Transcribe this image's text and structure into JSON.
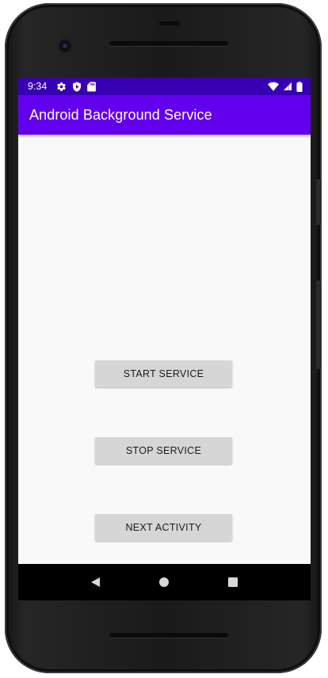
{
  "status_bar": {
    "time": "9:34",
    "left_icons": [
      "gear-icon",
      "shield-icon",
      "sd-card-icon"
    ],
    "right_icons": [
      "wifi-icon",
      "signal-icon",
      "battery-icon"
    ],
    "color": "#3700b3"
  },
  "app_bar": {
    "title": "Android Background Service",
    "color": "#6200ee"
  },
  "buttons": {
    "start_service": "START SERVICE",
    "stop_service": "STOP SERVICE",
    "next_activity": "NEXT ACTIVITY"
  },
  "nav_bar": {
    "icons": [
      "back-icon",
      "home-icon",
      "recents-icon"
    ]
  }
}
